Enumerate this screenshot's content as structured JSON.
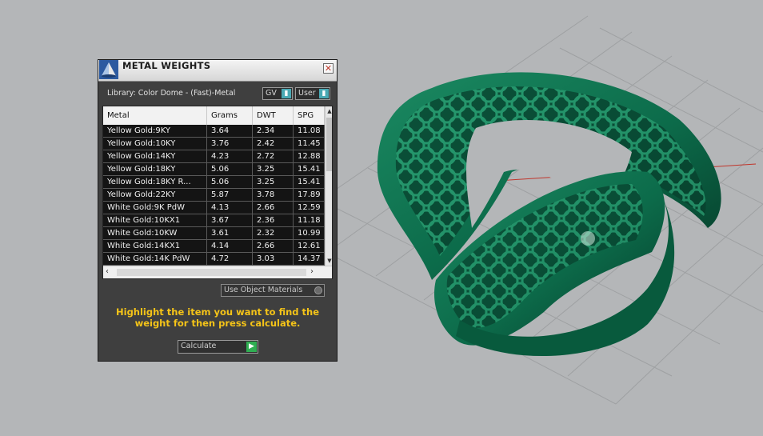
{
  "dialog": {
    "title": "METAL WEIGHTS",
    "library_label": "Library: Color Dome - (Fast)-Metal",
    "toggles": {
      "gv": "GV",
      "user": "User"
    },
    "close_glyph": "✕",
    "table": {
      "headers": [
        "Metal",
        "Grams",
        "DWT",
        "SPG"
      ],
      "rows": [
        [
          "Yellow Gold:9KY",
          "3.64",
          "2.34",
          "11.08"
        ],
        [
          "Yellow Gold:10KY",
          "3.76",
          "2.42",
          "11.45"
        ],
        [
          "Yellow Gold:14KY",
          "4.23",
          "2.72",
          "12.88"
        ],
        [
          "Yellow Gold:18KY",
          "5.06",
          "3.25",
          "15.41"
        ],
        [
          "Yellow Gold:18KY R...",
          "5.06",
          "3.25",
          "15.41"
        ],
        [
          "Yellow Gold:22KY",
          "5.87",
          "3.78",
          "17.89"
        ],
        [
          "White Gold:9K PdW",
          "4.13",
          "2.66",
          "12.59"
        ],
        [
          "White Gold:10KX1",
          "3.67",
          "2.36",
          "11.18"
        ],
        [
          "White Gold:10KW",
          "3.61",
          "2.32",
          "10.99"
        ],
        [
          "White Gold:14KX1",
          "4.14",
          "2.66",
          "12.61"
        ],
        [
          "White Gold:14K PdW",
          "4.72",
          "3.03",
          "14.37"
        ]
      ]
    },
    "use_object_materials": "Use Object Materials",
    "instruction": "Highlight the item you want to find the weight for then press calculate.",
    "calculate": "Calculate"
  },
  "icons": {
    "title": "pyramid-icon",
    "close": "close-icon",
    "scroll_up": "arrow-up-icon",
    "scroll_down": "arrow-down-icon",
    "scroll_left": "arrow-left-icon",
    "scroll_right": "arrow-right-icon",
    "calculate": "play-icon"
  },
  "colors": {
    "viewport_bg": "#b4b6b8",
    "grid": "#9a9c9e",
    "ring": "#0c6b4a",
    "panel": "#3f3f3f",
    "instruction": "#f5c418",
    "accent_toggle": "#49a9b4",
    "calculate_button": "#2fae52"
  }
}
